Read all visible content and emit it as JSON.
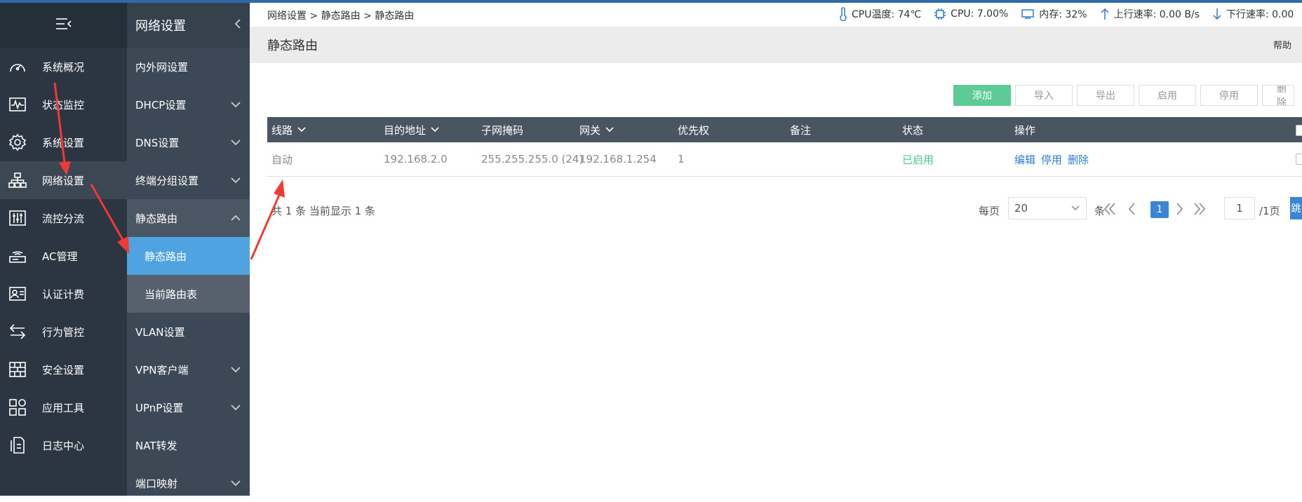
{
  "sidebar": {
    "items": [
      {
        "label": "系统概况",
        "icon": "dashboard-icon"
      },
      {
        "label": "状态监控",
        "icon": "monitor-icon"
      },
      {
        "label": "系统设置",
        "icon": "gear-icon"
      },
      {
        "label": "网络设置",
        "icon": "network-icon"
      },
      {
        "label": "流控分流",
        "icon": "sliders-icon"
      },
      {
        "label": "AC管理",
        "icon": "router-icon"
      },
      {
        "label": "认证计费",
        "icon": "id-card-icon"
      },
      {
        "label": "行为管控",
        "icon": "swap-icon"
      },
      {
        "label": "安全设置",
        "icon": "firewall-icon"
      },
      {
        "label": "应用工具",
        "icon": "apps-icon"
      },
      {
        "label": "日志中心",
        "icon": "log-icon"
      }
    ]
  },
  "subnav": {
    "title": "网络设置",
    "items": [
      {
        "label": "内外网设置"
      },
      {
        "label": "DHCP设置"
      },
      {
        "label": "DNS设置"
      },
      {
        "label": "终端分组设置"
      },
      {
        "label": "静态路由"
      },
      {
        "label": "静态路由"
      },
      {
        "label": "当前路由表"
      },
      {
        "label": "VLAN设置"
      },
      {
        "label": "VPN客户端"
      },
      {
        "label": "UPnP设置"
      },
      {
        "label": "NAT转发"
      },
      {
        "label": "端口映射"
      }
    ]
  },
  "header": {
    "breadcrumb": "网络设置 > 静态路由 > 静态路由",
    "cpu_temp": "CPU温度: 74℃",
    "cpu": "CPU: 7.00%",
    "memory": "内存: 32%",
    "upload": "上行速率: 0.00 B/s",
    "download": "下行速率: 0.00"
  },
  "page": {
    "title": "静态路由",
    "help": "帮助"
  },
  "toolbar": {
    "add": "添加",
    "import": "导入",
    "export": "导出",
    "enable": "启用",
    "disable": "停用",
    "delete": "删除"
  },
  "table": {
    "headers": [
      "线路",
      "目的地址",
      "子网掩码",
      "网关",
      "优先权",
      "备注",
      "状态",
      "操作"
    ],
    "rows": [
      {
        "line": "自动",
        "dest": "192.168.2.0",
        "mask": "255.255.255.0 (24)",
        "gateway": "192.168.1.254",
        "priority": "1",
        "note": "",
        "status": "已启用",
        "edit": "编辑",
        "disable": "停用",
        "delete": "删除"
      }
    ]
  },
  "pager": {
    "total": "共 1 条 当前显示 1 条",
    "per_page_label": "每页",
    "per_page": "20",
    "unit": "条",
    "current": "1",
    "page_input": "1",
    "page_total": "/1页",
    "go": "跳"
  },
  "colors": {
    "accent": "#4fa3e0",
    "add_button": "#5ccb96",
    "status_enabled": "#4cc48a",
    "annotation_arrow": "#f23a32"
  }
}
